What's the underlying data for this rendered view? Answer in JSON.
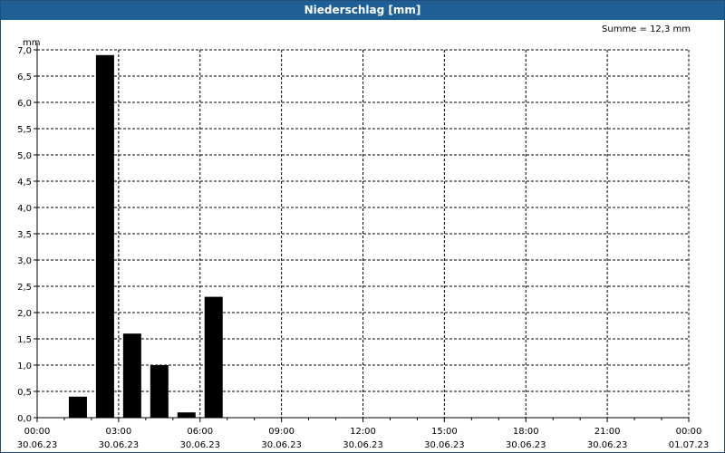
{
  "window": {
    "title": "Niederschlag [mm]"
  },
  "summary": "Summe = 12,3 mm",
  "chart_data": {
    "type": "bar",
    "title": "Niederschlag [mm]",
    "ylabel": "mm",
    "ylim": [
      0,
      7.0
    ],
    "grid": true,
    "y_ticks": [
      "0,0",
      "0,5",
      "1,0",
      "1,5",
      "2,0",
      "2,5",
      "3,0",
      "3,5",
      "4,0",
      "4,5",
      "5,0",
      "5,5",
      "6,0",
      "6,5",
      "7,0"
    ],
    "x_ticks": [
      {
        "time": "00:00",
        "date": "30.06.23"
      },
      {
        "time": "03:00",
        "date": "30.06.23"
      },
      {
        "time": "06:00",
        "date": "30.06.23"
      },
      {
        "time": "09:00",
        "date": "30.06.23"
      },
      {
        "time": "12:00",
        "date": "30.06.23"
      },
      {
        "time": "15:00",
        "date": "30.06.23"
      },
      {
        "time": "18:00",
        "date": "30.06.23"
      },
      {
        "time": "21:00",
        "date": "30.06.23"
      },
      {
        "time": "00:00",
        "date": "01.07.23"
      }
    ],
    "bar_color": "#000000",
    "series": [
      {
        "values": [
          {
            "time": "30.06.23 01:00-02:00",
            "value": 0.4
          },
          {
            "time": "30.06.23 02:00-03:00",
            "value": 6.9
          },
          {
            "time": "30.06.23 03:00-04:00",
            "value": 1.6
          },
          {
            "time": "30.06.23 04:00-05:00",
            "value": 1.0
          },
          {
            "time": "30.06.23 05:00-06:00",
            "value": 0.1
          },
          {
            "time": "30.06.23 06:00-07:00",
            "value": 2.3
          }
        ]
      }
    ]
  }
}
